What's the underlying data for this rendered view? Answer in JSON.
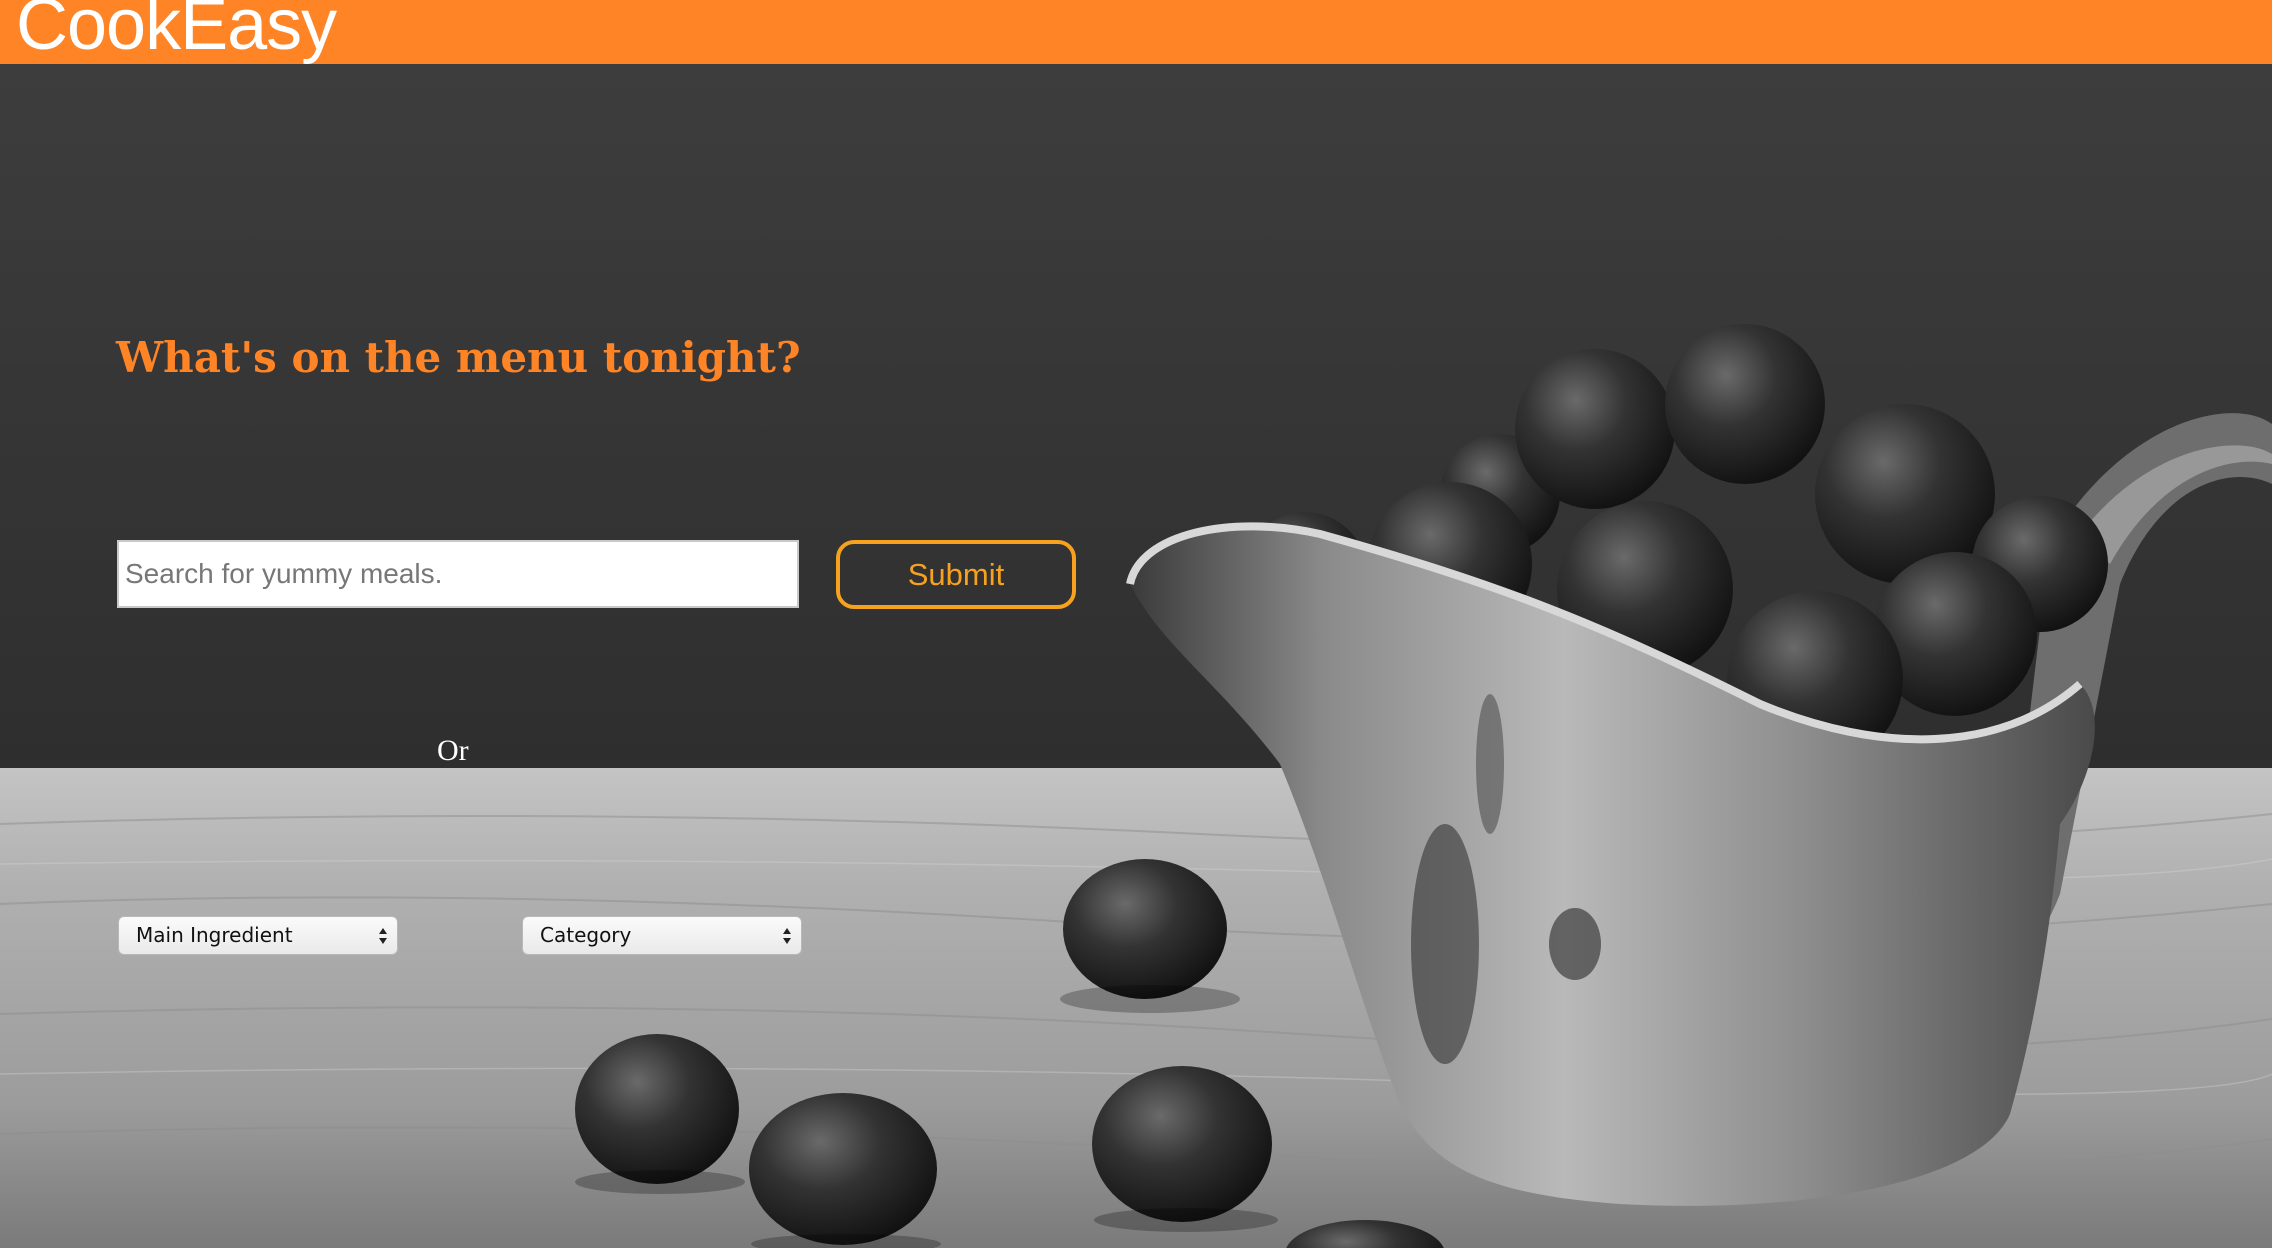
{
  "header": {
    "logo_text": "CookEasy",
    "background_color": "#ff8426"
  },
  "hero": {
    "headline": "What's on the menu tonight?",
    "headline_color": "#ff8426",
    "search": {
      "placeholder": "Search for yummy meals.",
      "value": ""
    },
    "submit_label": "Submit",
    "submit_color": "#f6a21e",
    "or_label": "Or",
    "filters": {
      "main_ingredient_selected": "Main Ingredient",
      "category_selected": "Category"
    },
    "background_image": "black-and-white photo of a silver pitcher filled with blueberries on a wooden table"
  }
}
